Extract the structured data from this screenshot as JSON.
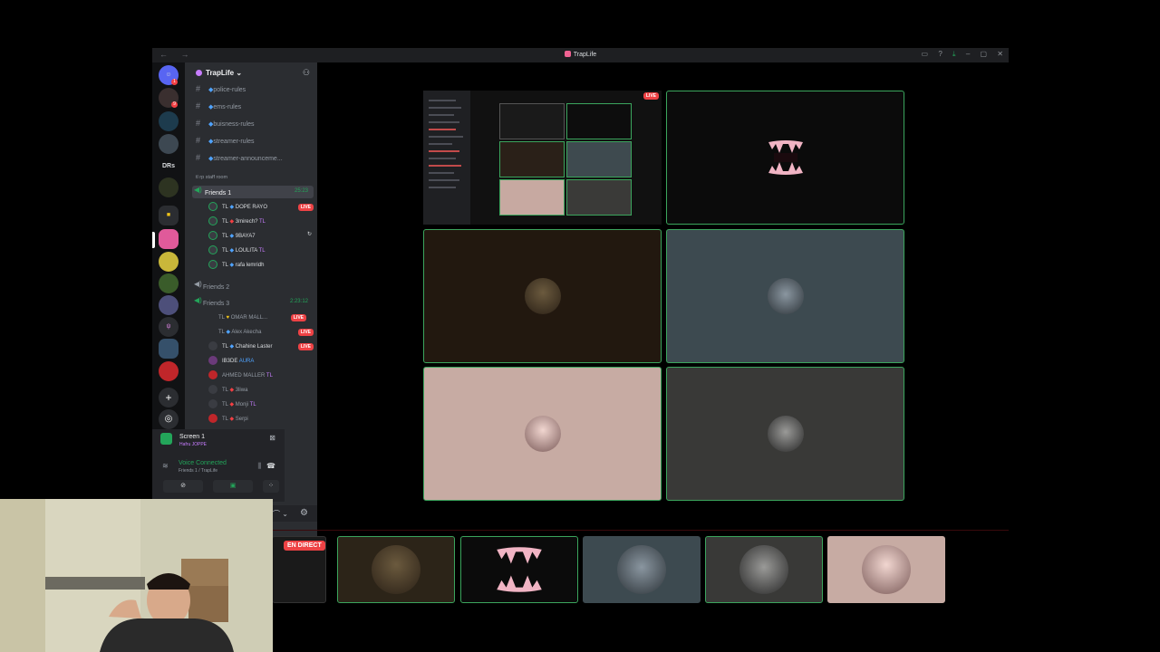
{
  "window": {
    "title": "TrapLife",
    "nav": "← →",
    "controls": [
      "▭",
      "?",
      "⤓",
      "–",
      "▢",
      "✕"
    ]
  },
  "rail": {
    "label_drs": "DRs",
    "badges": [
      "1",
      "9"
    ]
  },
  "sidebar": {
    "server_name": "TrapLife",
    "channels": [
      {
        "name": "police-rules"
      },
      {
        "name": "ems-rules"
      },
      {
        "name": "buisness-rules"
      },
      {
        "name": "streamer-rules"
      },
      {
        "name": "streamer-announceme..."
      }
    ],
    "category": "tl rp staff room",
    "voice_channels": [
      {
        "name": "Friends 1",
        "time": "25:23"
      },
      {
        "name": "Friends 2",
        "time": ""
      },
      {
        "name": "Friends 3",
        "time": "2:23:12"
      }
    ],
    "friends1_members": [
      {
        "prefix": "TL",
        "name": "DOPE RAYO",
        "live": "LIVE"
      },
      {
        "prefix": "TL",
        "name": "3mirech?",
        "tag": "TL"
      },
      {
        "prefix": "TL",
        "name": "9BAYA7"
      },
      {
        "prefix": "TL",
        "name": "LOULITA",
        "tag": "TL"
      },
      {
        "prefix": "TL",
        "name": "rafa lemridh"
      }
    ],
    "friends3_members": [
      {
        "prefix": "TL",
        "name": "OMAR MALL...",
        "live": "LIVE"
      },
      {
        "prefix": "TL",
        "name": "Alex Akecha",
        "live": "LIVE"
      },
      {
        "prefix": "TL",
        "name": "Chahine Laster",
        "live": "LIVE"
      },
      {
        "prefix": "",
        "name": "IB3DE",
        "tag": "AURA"
      },
      {
        "prefix": "",
        "name": "AHMED MALLER",
        "tag": "TL"
      },
      {
        "prefix": "TL",
        "name": "3liwa"
      },
      {
        "prefix": "TL",
        "name": "Monji",
        "tag": "TL"
      },
      {
        "prefix": "TL",
        "name": "Serpi"
      }
    ]
  },
  "screen_panel": {
    "title": "Screen 1",
    "subtitle": "Hafru JOPPE",
    "voice_status": "Voice Connected",
    "voice_location": "Friends 1 / TrapLife"
  },
  "stage": {
    "live_label": "LIVE",
    "en_direct": "EN DIRECT"
  },
  "colors": {
    "accent_green": "#3ba55d",
    "live_red": "#ed4245",
    "sidebar_bg": "#2b2d31"
  }
}
